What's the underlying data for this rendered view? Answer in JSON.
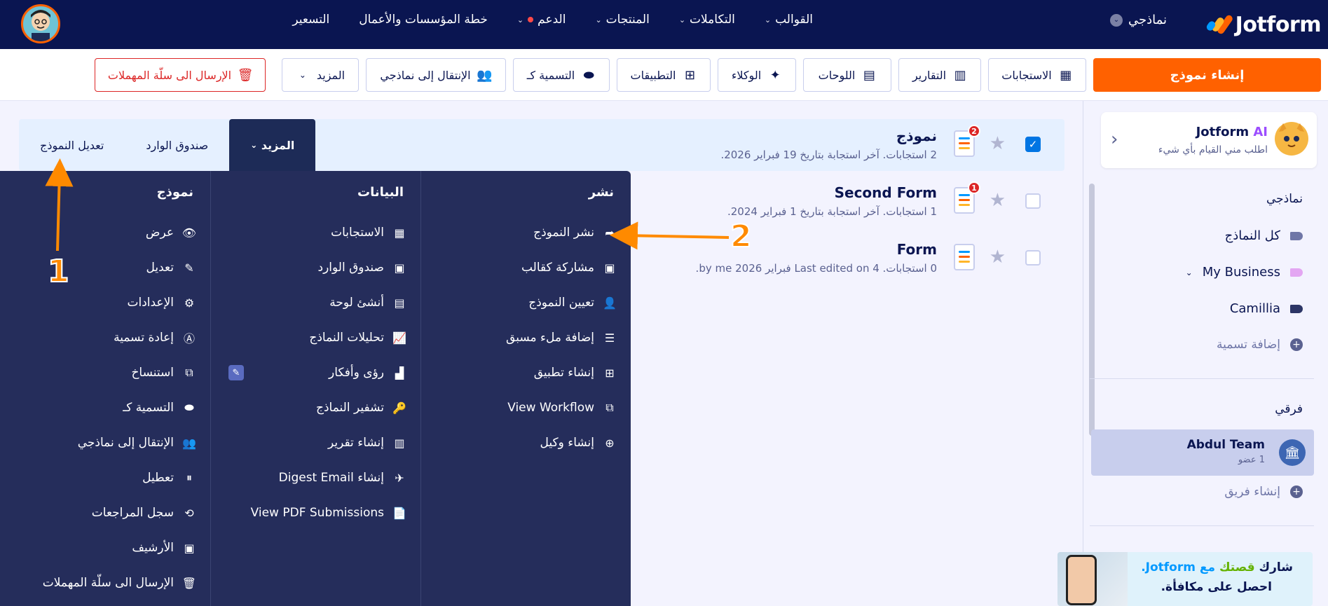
{
  "topnav": {
    "logo_text": "Jotform",
    "my_forms": "نماذجي",
    "links": [
      "القوالب",
      "التكاملات",
      "المنتجات",
      "الدعم",
      "خطة المؤسسات والأعمال",
      "التسعير"
    ]
  },
  "toolbar": {
    "create": "إنشاء نموذج",
    "responses": "الاستجابات",
    "reports": "التقارير",
    "boards": "اللوحات",
    "agents": "الوكلاء",
    "apps": "التطبيقات",
    "label_as": "التسمية كـ",
    "move_to": "الإنتقال إلى نماذجي",
    "more": "المزيد",
    "trash": "الإرسال الى سلّة المهملات"
  },
  "sidebar": {
    "ai_title_brand": "Jotform",
    "ai_title_ai": "AI",
    "ai_sub": "اطلب مني القيام بأي شيء",
    "my_forms_heading": "نماذجي",
    "folders": [
      {
        "label": "كل النماذج",
        "color": "#6f76a7"
      },
      {
        "label": "My Business",
        "color": "#e3a6f2"
      },
      {
        "label": "Camillia",
        "color": "#2c3566"
      }
    ],
    "add_label": "إضافة تسمية",
    "team_heading": "فرقي",
    "team_name": "Abdul Team",
    "team_members": "1 عضو",
    "create_team": "إنشاء فريق",
    "promo_prefix": "شارك",
    "promo_story": "قصتك",
    "promo_with": "مع",
    "promo_brand": "Jotform.",
    "promo_line2": "احصل على مكافأة."
  },
  "forms": [
    {
      "title": "نموذج",
      "meta": "2 استجابات. آخر استجابة بتاريخ 19 فبراير 2026.",
      "badge": "2",
      "checked": true
    },
    {
      "title": "Second Form",
      "meta": "1 استجابات. آخر استجابة بتاريخ 1 فبراير 2024.",
      "badge": "1",
      "checked": false
    },
    {
      "title": "Form",
      "meta": "0 استجابات. Last edited on 4 فبراير 2026 by me.",
      "badge": "",
      "checked": false
    }
  ],
  "row_tabs": {
    "edit_form": "تعديل النموذج",
    "inbox": "صندوق الوارد",
    "more": "المزيد"
  },
  "menu": {
    "publish": {
      "heading": "نشر",
      "items": [
        "نشر النموذج",
        "مشاركة كقالب",
        "تعيين النموذج",
        "إضافة ملء مسبق",
        "إنشاء تطبيق",
        "View Workflow",
        "إنشاء وكيل"
      ]
    },
    "data": {
      "heading": "البيانات",
      "items": [
        "الاستجابات",
        "صندوق الوارد",
        "أنشئ لوحة",
        "تحليلات النماذج",
        "رؤى وأفكار",
        "تشفير النماذج",
        "إنشاء تقرير",
        "إنشاء Digest Email",
        "View PDF Submissions"
      ]
    },
    "form": {
      "heading": "نموذج",
      "items": [
        "عرض",
        "تعديل",
        "الإعدادات",
        "إعادة تسمية",
        "استنساخ",
        "التسمية كـ",
        "الإنتقال إلى نماذجي",
        "تعطيل",
        "سجل المراجعات",
        "الأرشيف",
        "الإرسال الى سلّة المهملات"
      ]
    }
  },
  "annotations": {
    "step1": "1",
    "step2": "2",
    "color": "#ff8a00"
  },
  "colors": {
    "navy": "#0a1551",
    "orange": "#ff6100",
    "panel": "#252d5b",
    "blue": "#0075e3"
  }
}
